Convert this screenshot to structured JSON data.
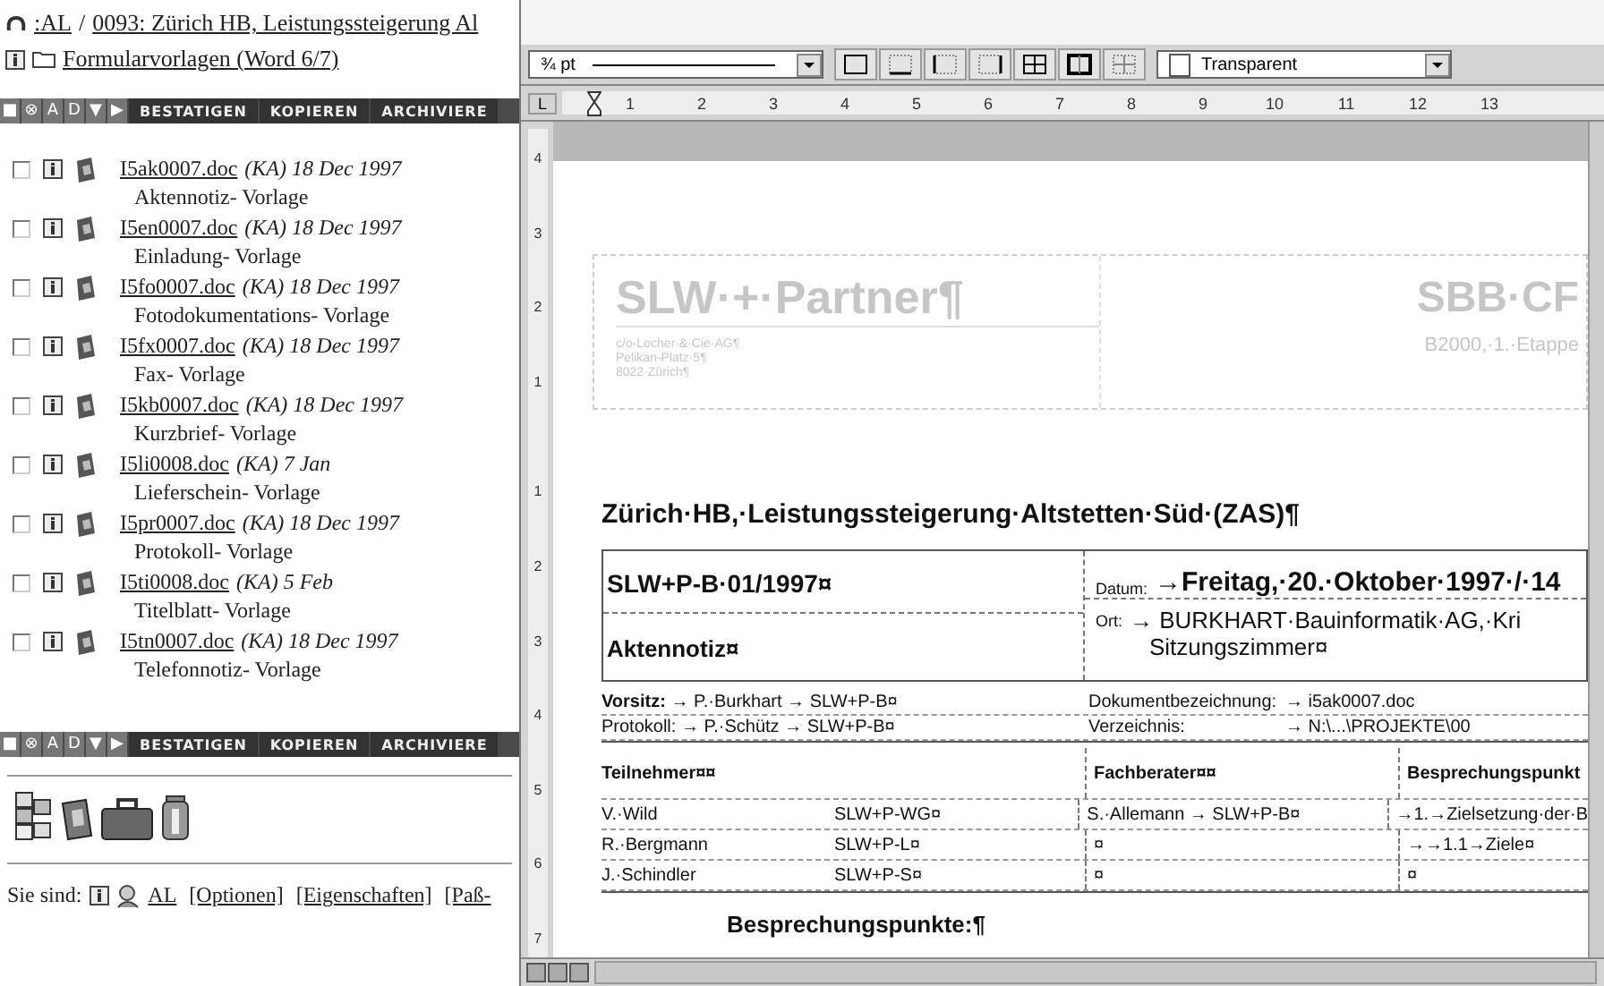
{
  "browser": {
    "breadcrumb": {
      "root": ":AL",
      "separator": "/",
      "path": "0093: Zürich HB, Leistungssteigerung Al"
    },
    "folder": "Formularvorlagen (Word 6/7)",
    "action_bar_top": {
      "icons": [
        "■",
        "⊗",
        "A",
        "D",
        "▼",
        "▶"
      ],
      "buttons": [
        "BESTATIGEN",
        "KOPIEREN",
        "ARCHIVIERE"
      ]
    },
    "items": [
      {
        "file": "I5ak0007.doc",
        "meta": "(KA) 18 Dec 1997",
        "description": "Aktennotiz- Vorlage",
        "checked": false
      },
      {
        "file": "I5en0007.doc",
        "meta": "(KA) 18 Dec 1997",
        "description": "Einladung- Vorlage",
        "checked": false
      },
      {
        "file": "I5fo0007.doc",
        "meta": "(KA) 18 Dec 1997",
        "description": "Fotodokumentations- Vorlage",
        "checked": false
      },
      {
        "file": "I5fx0007.doc",
        "meta": "(KA) 18 Dec 1997",
        "description": "Fax- Vorlage",
        "checked": false
      },
      {
        "file": "I5kb0007.doc",
        "meta": "(KA) 18 Dec 1997",
        "description": "Kurzbrief- Vorlage",
        "checked": false
      },
      {
        "file": "I5li0008.doc",
        "meta": "(KA) 7 Jan",
        "description": "Lieferschein- Vorlage",
        "checked": false
      },
      {
        "file": "I5pr0007.doc",
        "meta": "(KA) 18 Dec 1997",
        "description": "Protokoll- Vorlage",
        "checked": false
      },
      {
        "file": "I5ti0008.doc",
        "meta": "(KA) 5 Feb",
        "description": "Titelblatt- Vorlage",
        "checked": false
      },
      {
        "file": "I5tn0007.doc",
        "meta": "(KA) 18 Dec 1997",
        "description": "Telefonnotiz- Vorlage",
        "checked": false
      }
    ],
    "action_bar_bottom": {
      "icons": [
        "■",
        "⊗",
        "A",
        "D",
        "▼",
        "▶"
      ],
      "buttons": [
        "BESTATIGEN",
        "KOPIEREN",
        "ARCHIVIERE"
      ]
    },
    "footer": {
      "label": "Sie sind:",
      "user": "AL",
      "links": [
        "[Optionen]",
        "[Eigenschaften]",
        "[Paß-"
      ]
    }
  },
  "editor": {
    "toolbar": {
      "tab_selector": "L",
      "line_width": "¾ pt",
      "shading": "Transparent",
      "border_buttons": [
        {
          "kind": "outside"
        },
        {
          "kind": "bottom"
        },
        {
          "kind": "left"
        },
        {
          "kind": "right"
        },
        {
          "kind": "grid"
        },
        {
          "kind": "inside"
        },
        {
          "kind": "none"
        }
      ]
    },
    "ruler": [
      "1",
      "2",
      "3",
      "4",
      "5",
      "6",
      "7",
      "8",
      "9",
      "10",
      "11",
      "12",
      "13"
    ],
    "vertical_ruler": [
      "4",
      "3",
      "2",
      "1",
      "1",
      "2",
      "3",
      "4",
      "5",
      "6",
      "7"
    ],
    "document": {
      "letterhead": {
        "company": "SLW·+·Partner¶",
        "address": [
          "c/o·Locher·&·Cie·AG¶",
          "Pelikan-Platz·5¶",
          "8022·Zürich¶"
        ],
        "client": "SBB·CF",
        "project": "B2000,·1.·Etappe"
      },
      "title": "Zürich·HB,·Leistungssteigerung·Altstetten·Süd·(ZAS)¶",
      "header": {
        "number": "SLW+P-B·01/1997¤",
        "type": "Aktennotiz¤",
        "date_label": "Datum:",
        "date": "→Freitag,·20.·Oktober·1997·/·14",
        "place_label": "Ort:",
        "place": "→ BURKHART·Bauinformatik·AG,·Kri",
        "place_line_2": "Sitzungszimmer¤"
      },
      "info_rows": [
        {
          "left": "**Vorsitz:** → P.·Burkhart → SLW+P-B¤",
          "label": "Dokumentbezeichnung:",
          "value": "→   i5ak0007.doc"
        },
        {
          "left": "Protokoll: → P.·Schütz → SLW+P-B¤",
          "label": "Verzeichnis:",
          "value": "→   N:\\...\\PROJEKTE\\00"
        }
      ],
      "participants": {
        "headers": [
          "Teilnehmer¤¤",
          "Fachberater¤¤",
          "Besprechungspunkt"
        ],
        "rows": [
          {
            "name": "V.·Wild",
            "org": "SLW+P-WG¤",
            "advisor": "S.·Allemann → SLW+P-B¤",
            "topic": "→1.→Zielsetzung·der·B"
          },
          {
            "name": "R.·Bergmann",
            "org": "SLW+P-L¤",
            "advisor": "¤",
            "topic": "→→1.1→Ziele¤"
          },
          {
            "name": "J.·Schindler",
            "org": "SLW+P-S¤",
            "advisor": "¤",
            "topic": "¤"
          }
        ]
      },
      "section": "Besprechungspunkte:¶"
    }
  }
}
